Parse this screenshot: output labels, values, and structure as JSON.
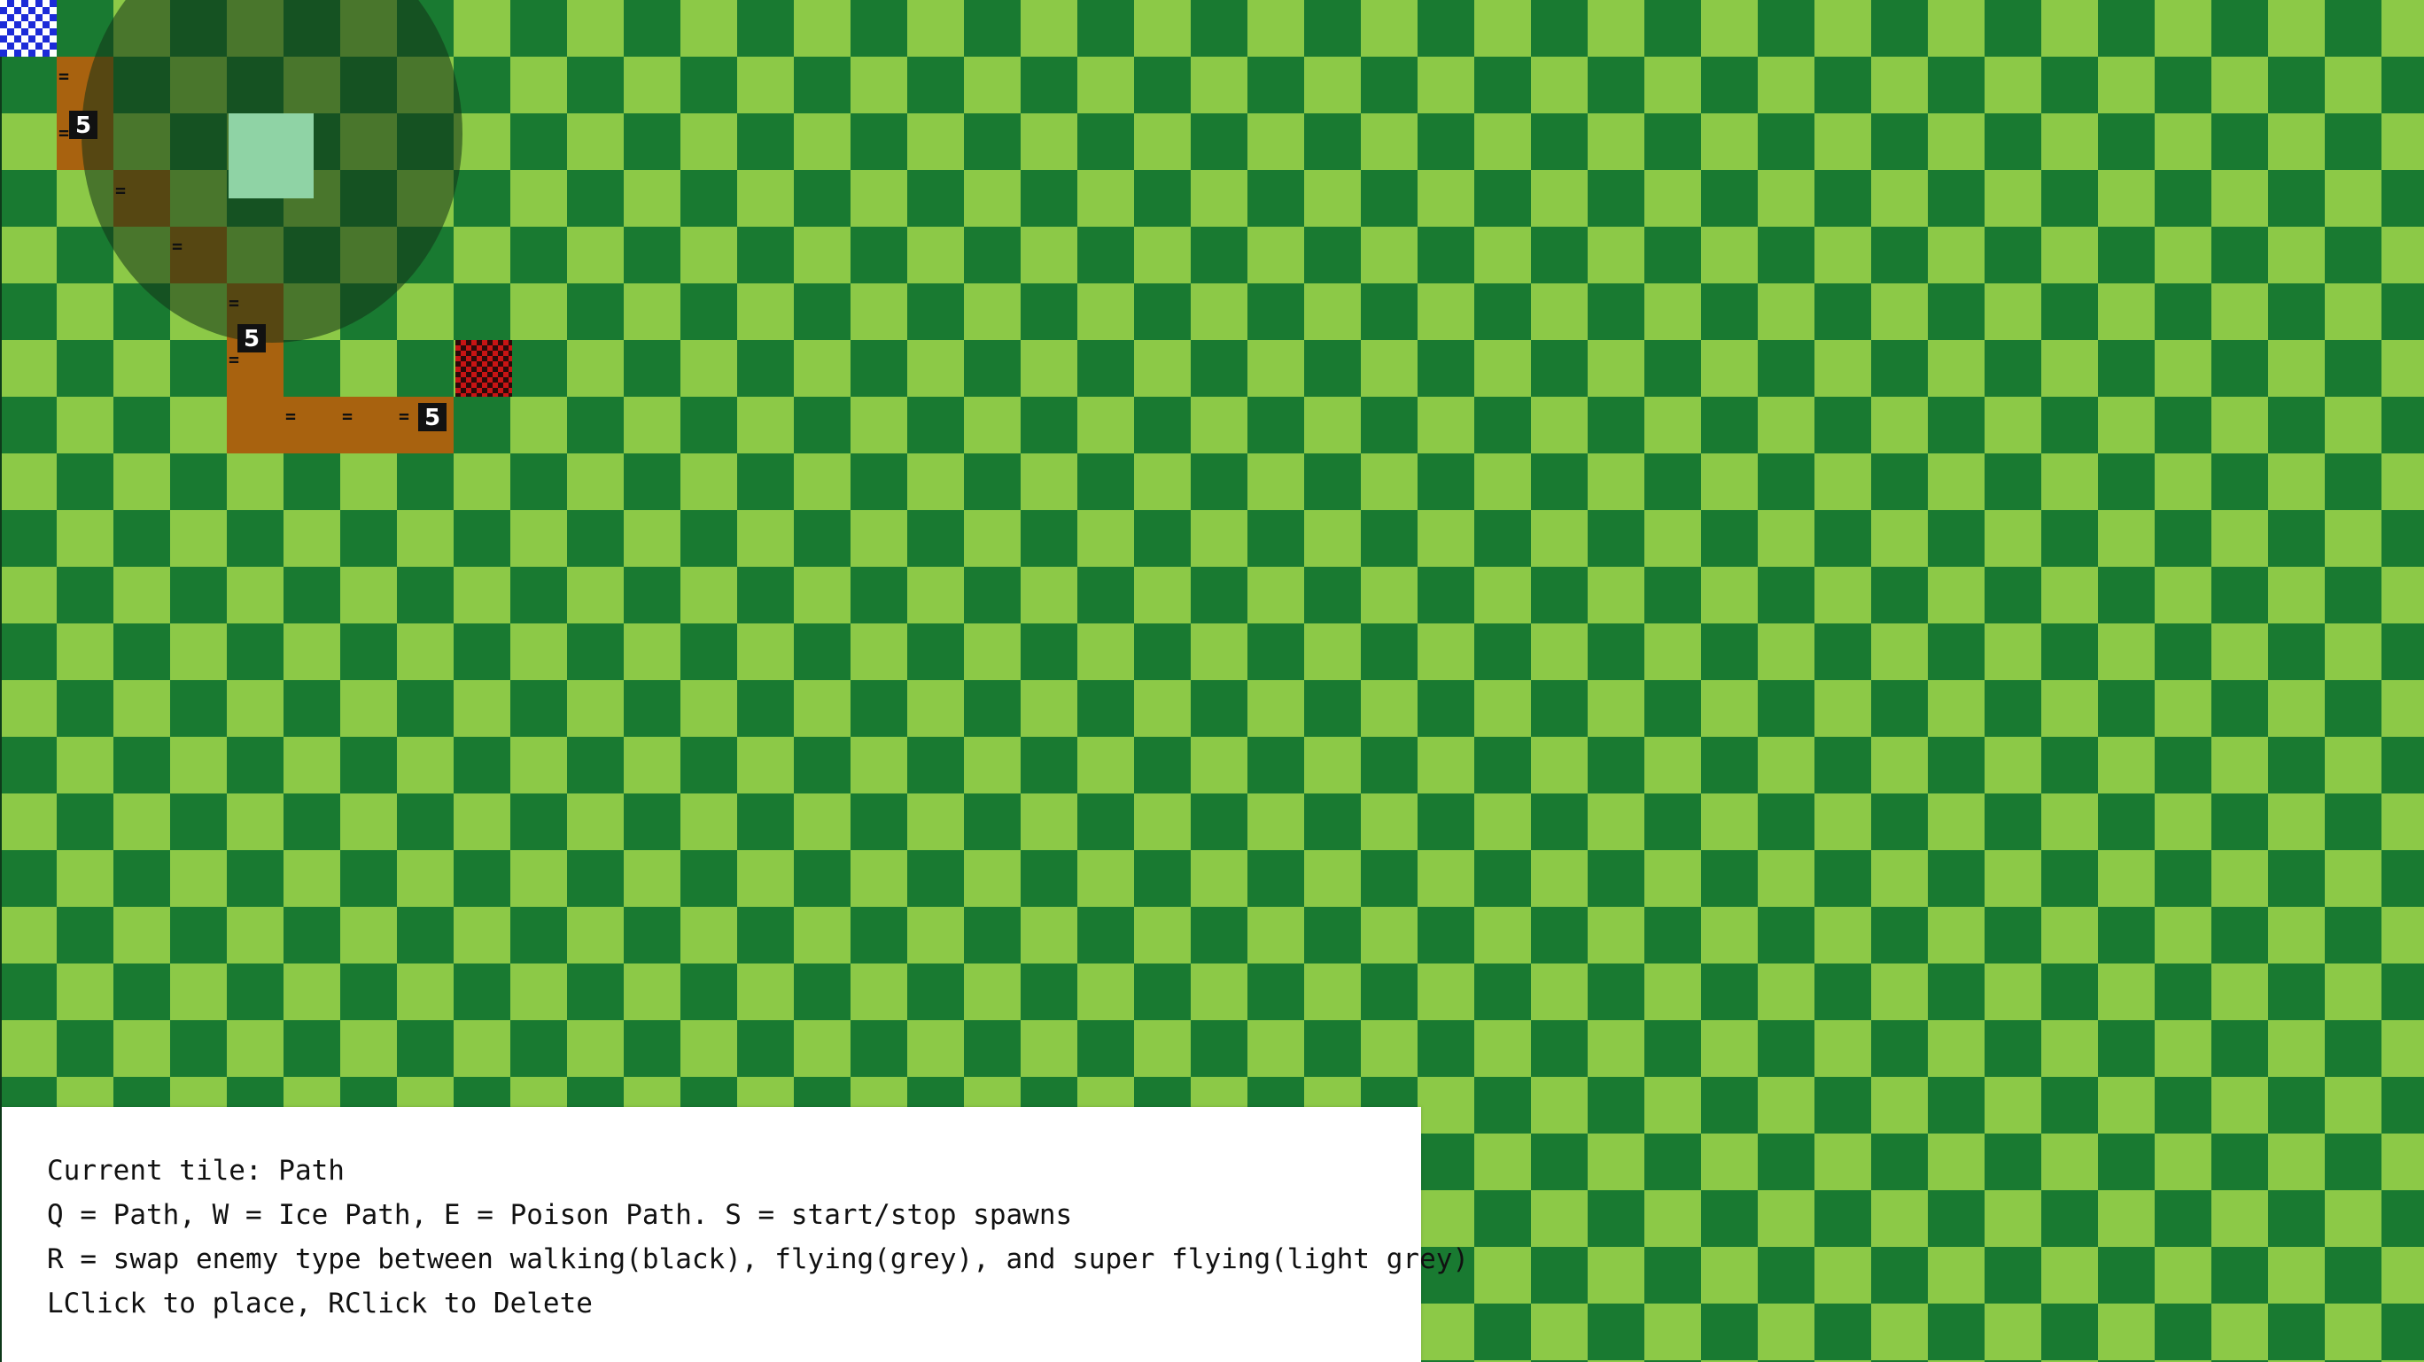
{
  "game": {
    "mode": "map-editor",
    "current_tile_label": "Current tile: Path",
    "help_lines": [
      "Q = Path, W = Ice Path, E = Poison Path. S = start/stop spawns",
      "R = swap enemy type between walking(black), flying(grey), and super flying(light grey)",
      "LClick to place, RClick to Delete"
    ],
    "path_marker": "=",
    "wave_label": "5",
    "colors": {
      "grass_light": "#8cc947",
      "grass_dark": "#197a31",
      "path": "#a8620f",
      "spawn_start": "#1c2bd8",
      "spawn_end": "#c81414",
      "cursor": "#8fd3a5",
      "tower_range": "#123216"
    },
    "tiles": {
      "spawn_start": "start-spawn-icon",
      "spawn_end": "end-spawn-icon"
    }
  }
}
